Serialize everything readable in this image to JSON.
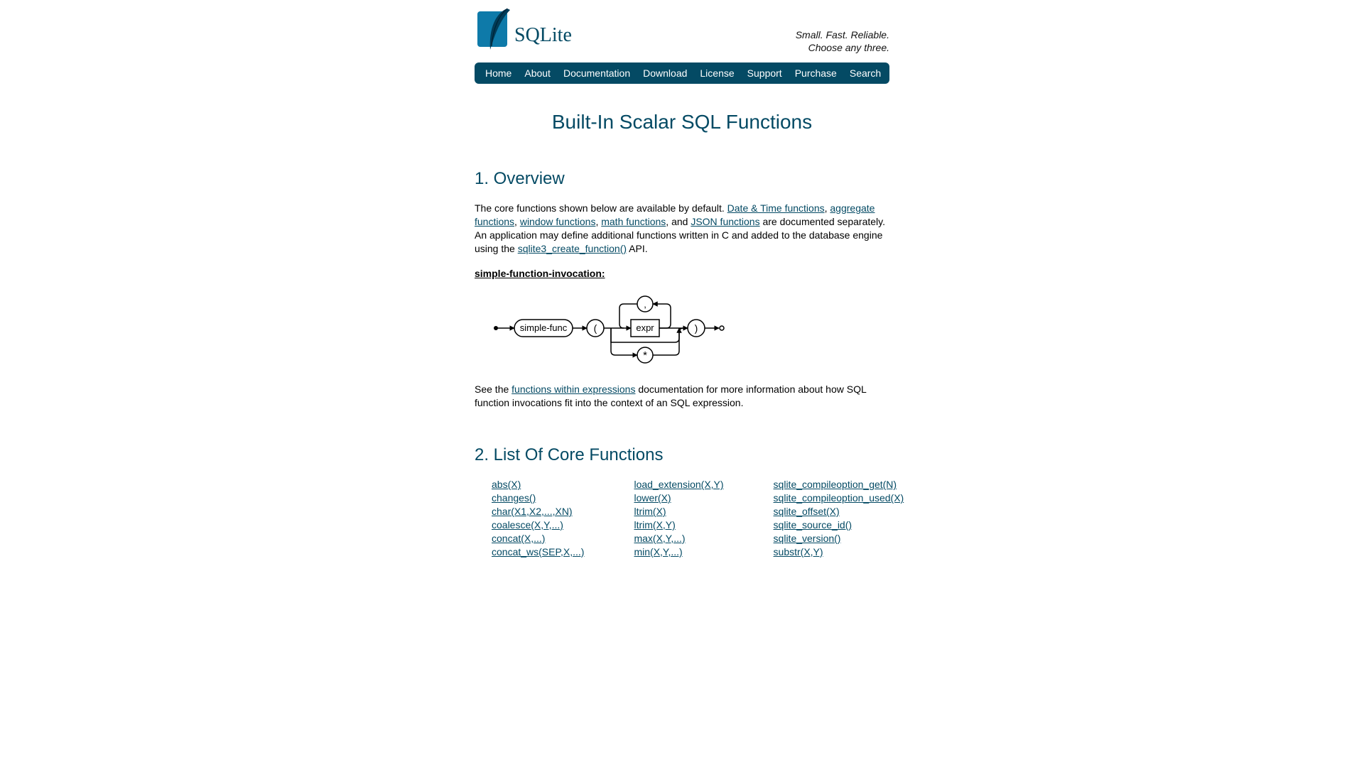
{
  "tagline": {
    "line1": "Small. Fast. Reliable.",
    "line2": "Choose any three."
  },
  "logo_text": "SQLite",
  "nav": {
    "home": "Home",
    "about": "About",
    "documentation": "Documentation",
    "download": "Download",
    "license": "License",
    "support": "Support",
    "purchase": "Purchase",
    "search": "Search"
  },
  "title": "Built-In Scalar SQL Functions",
  "section1": {
    "heading": "1. Overview",
    "para1_a": "The core functions shown below are available by default. ",
    "link_datetime": "Date & Time functions",
    "para1_b": ", ",
    "link_aggregate": "aggregate functions",
    "para1_c": ", ",
    "link_window": "window functions",
    "para1_d": ", ",
    "link_math": "math functions",
    "para1_e": ", and ",
    "link_json": "JSON functions",
    "para1_f": " are documented separately. An application may define additional functions written in C and added to the database engine using the ",
    "link_create_function": "sqlite3_create_function()",
    "para1_g": " API.",
    "invocation_label": "simple-function-invocation:",
    "diagram": {
      "simple_func": "simple-func",
      "lparen": "(",
      "expr": "expr",
      "comma": ",",
      "star": "*",
      "rparen": ")"
    },
    "para2_a": "See the ",
    "link_fn_expr": "functions within expressions",
    "para2_b": " documentation for more information about how SQL function invocations fit into the context of an SQL expression."
  },
  "section2": {
    "heading": "2. List Of Core Functions",
    "col1": {
      "0": "abs(X)",
      "1": "changes()",
      "2": "char(X1,X2,...,XN)",
      "3": "coalesce(X,Y,...)",
      "4": "concat(X,...)",
      "5": "concat_ws(SEP,X,...)"
    },
    "col2": {
      "0": "load_extension(X,Y)",
      "1": "lower(X)",
      "2": "ltrim(X)",
      "3": "ltrim(X,Y)",
      "4": "max(X,Y,...)",
      "5": "min(X,Y,...)"
    },
    "col3": {
      "0": "sqlite_compileoption_get(N)",
      "1": "sqlite_compileoption_used(X)",
      "2": "sqlite_offset(X)",
      "3": "sqlite_source_id()",
      "4": "sqlite_version()",
      "5": "substr(X,Y)"
    }
  }
}
